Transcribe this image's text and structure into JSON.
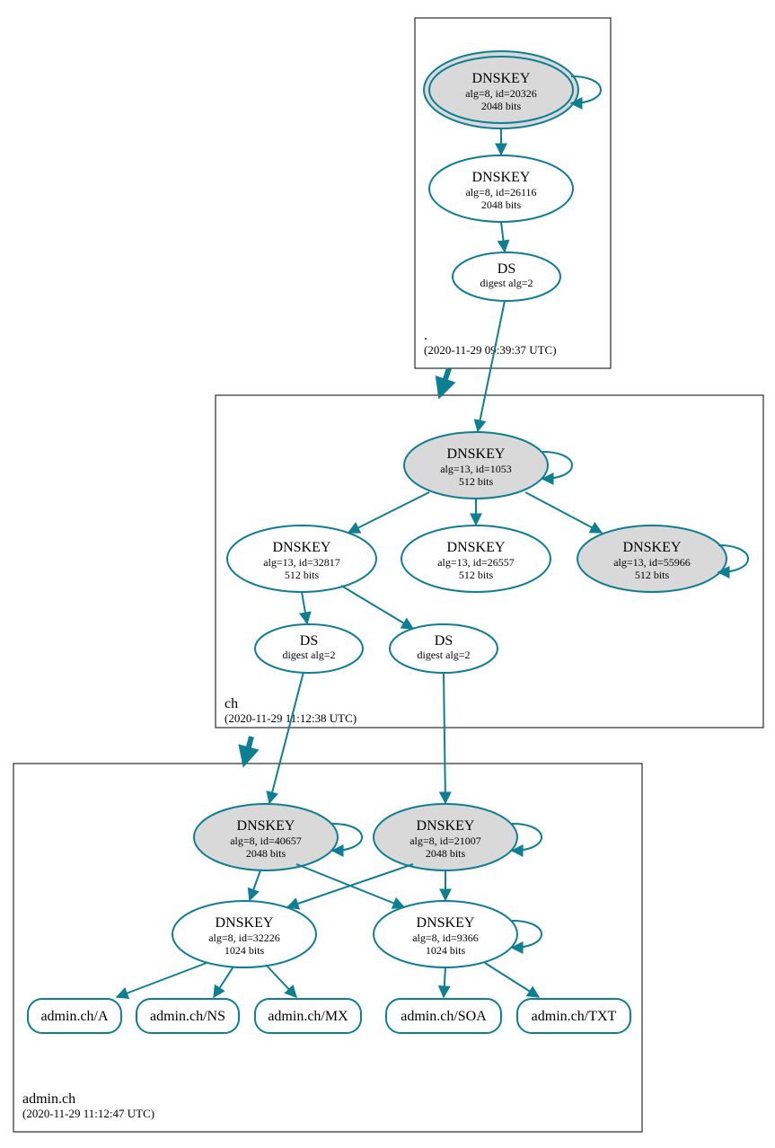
{
  "zones": {
    "root": {
      "label": ".",
      "timestamp": "(2020-11-29 09:39:37 UTC)"
    },
    "ch": {
      "label": "ch",
      "timestamp": "(2020-11-29 11:12:38 UTC)"
    },
    "admin": {
      "label": "admin.ch",
      "timestamp": "(2020-11-29 11:12:47 UTC)"
    }
  },
  "nodes": {
    "root_ksk": {
      "title": "DNSKEY",
      "sub1": "alg=8, id=20326",
      "sub2": "2048 bits"
    },
    "root_zsk": {
      "title": "DNSKEY",
      "sub1": "alg=8, id=26116",
      "sub2": "2048 bits"
    },
    "root_ds": {
      "title": "DS",
      "sub1": "digest alg=2"
    },
    "ch_ksk": {
      "title": "DNSKEY",
      "sub1": "alg=13, id=1053",
      "sub2": "512 bits"
    },
    "ch_z1": {
      "title": "DNSKEY",
      "sub1": "alg=13, id=32817",
      "sub2": "512 bits"
    },
    "ch_z2": {
      "title": "DNSKEY",
      "sub1": "alg=13, id=26557",
      "sub2": "512 bits"
    },
    "ch_z3": {
      "title": "DNSKEY",
      "sub1": "alg=13, id=55966",
      "sub2": "512 bits"
    },
    "ch_ds1": {
      "title": "DS",
      "sub1": "digest alg=2"
    },
    "ch_ds2": {
      "title": "DS",
      "sub1": "digest alg=2"
    },
    "adm_k1": {
      "title": "DNSKEY",
      "sub1": "alg=8, id=40657",
      "sub2": "2048 bits"
    },
    "adm_k2": {
      "title": "DNSKEY",
      "sub1": "alg=8, id=21007",
      "sub2": "2048 bits"
    },
    "adm_z1": {
      "title": "DNSKEY",
      "sub1": "alg=8, id=32226",
      "sub2": "1024 bits"
    },
    "adm_z2": {
      "title": "DNSKEY",
      "sub1": "alg=8, id=9366",
      "sub2": "1024 bits"
    },
    "rr_a": {
      "label": "admin.ch/A"
    },
    "rr_ns": {
      "label": "admin.ch/NS"
    },
    "rr_mx": {
      "label": "admin.ch/MX"
    },
    "rr_soa": {
      "label": "admin.ch/SOA"
    },
    "rr_txt": {
      "label": "admin.ch/TXT"
    }
  },
  "colors": {
    "stroke": "#0e7e92",
    "shade": "#d9d9d9"
  }
}
